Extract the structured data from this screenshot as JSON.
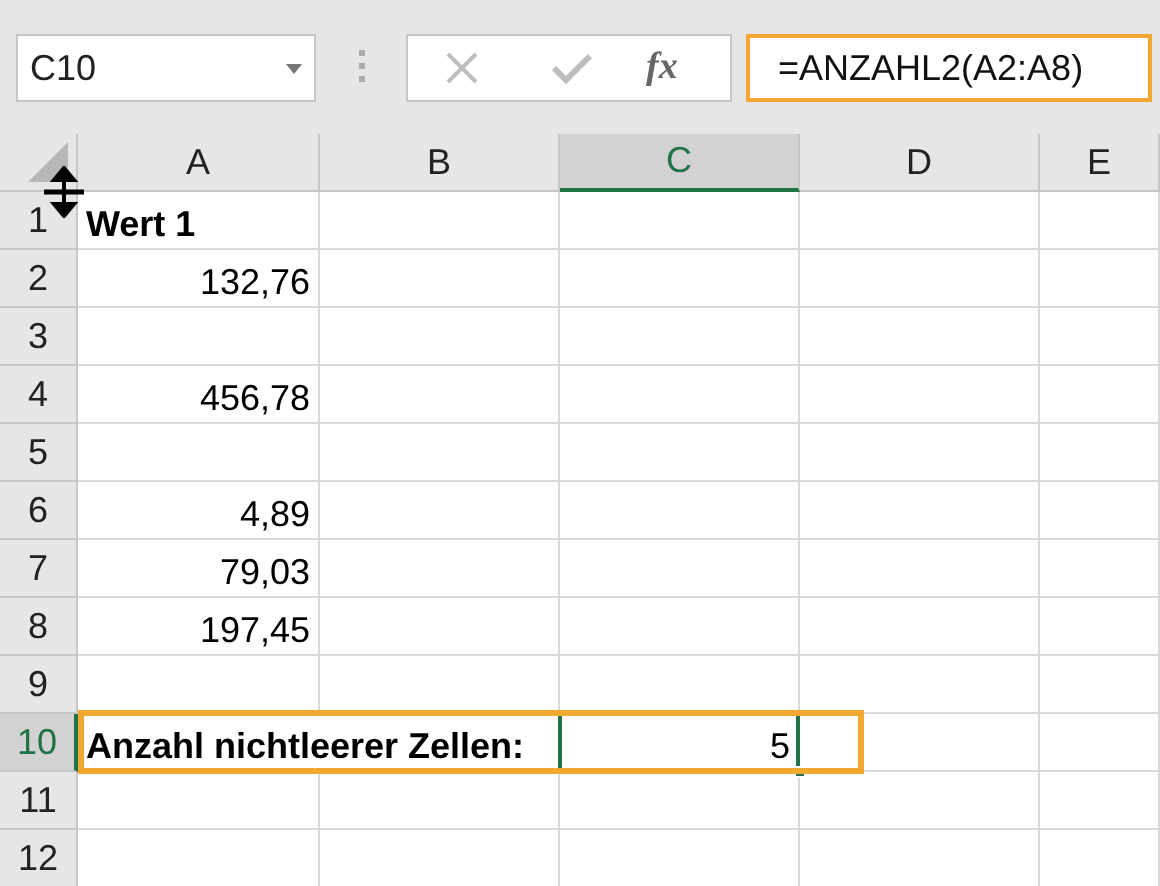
{
  "name_box": {
    "value": "C10"
  },
  "formula_bar": {
    "function_label": "fx",
    "value": "=ANZAHL2(A2:A8)",
    "highlighted": true
  },
  "columns": [
    {
      "label": "A",
      "selected": false
    },
    {
      "label": "B",
      "selected": false
    },
    {
      "label": "C",
      "selected": true
    },
    {
      "label": "D",
      "selected": false
    },
    {
      "label": "E",
      "selected": false
    }
  ],
  "rows": [
    {
      "number": "1",
      "selected": false,
      "highlighted": false,
      "cell_a": {
        "kind": "label",
        "text": "Wert 1",
        "selected": false
      }
    },
    {
      "number": "2",
      "selected": false,
      "highlighted": false,
      "cell_a": {
        "kind": "number",
        "text": "132,76",
        "selected": false
      }
    },
    {
      "number": "3",
      "selected": false,
      "highlighted": false
    },
    {
      "number": "4",
      "selected": false,
      "highlighted": false,
      "cell_a": {
        "kind": "number",
        "text": "456,78",
        "selected": false
      }
    },
    {
      "number": "5",
      "selected": false,
      "highlighted": false
    },
    {
      "number": "6",
      "selected": false,
      "highlighted": false,
      "cell_a": {
        "kind": "number",
        "text": "4,89",
        "selected": false
      }
    },
    {
      "number": "7",
      "selected": false,
      "highlighted": false,
      "cell_a": {
        "kind": "number",
        "text": "79,03",
        "selected": false
      }
    },
    {
      "number": "8",
      "selected": false,
      "highlighted": false,
      "cell_a": {
        "kind": "number",
        "text": "197,45",
        "selected": false
      }
    },
    {
      "number": "9",
      "selected": false,
      "highlighted": false
    },
    {
      "number": "10",
      "selected": true,
      "highlighted": true,
      "cell_a": {
        "kind": "label",
        "text": "Anzahl nichtleerer Zellen:",
        "selected": false
      },
      "cell_c": {
        "kind": "number",
        "text": "5",
        "selected": true
      }
    },
    {
      "number": "11",
      "selected": false,
      "highlighted": false
    },
    {
      "number": "12",
      "selected": false,
      "highlighted": false
    }
  ]
}
